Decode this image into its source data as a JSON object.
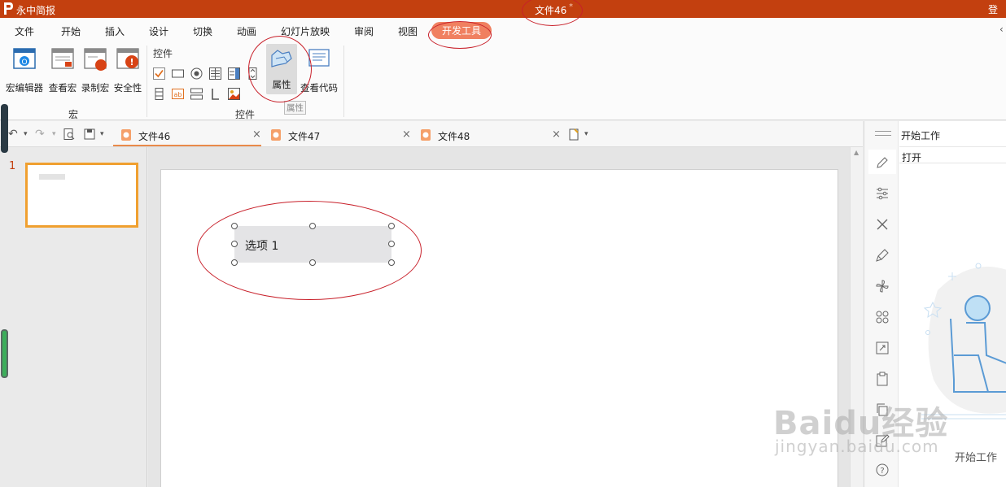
{
  "app": {
    "name": "永中简报",
    "document_title": "文件46",
    "modified_mark": "*",
    "login": "登录"
  },
  "menu": {
    "items": [
      "文件",
      "开始",
      "插入",
      "设计",
      "切换",
      "动画",
      "幻灯片放映",
      "审阅",
      "视图"
    ],
    "active": "开发工具"
  },
  "ribbon": {
    "macro_group": {
      "title": "宏",
      "buttons": [
        "宏编辑器",
        "查看宏",
        "录制宏",
        "安全性"
      ]
    },
    "controls_group": {
      "header": "控件",
      "title": "控件",
      "property_button": "属性",
      "view_code_button": "查看代码",
      "tooltip": "属性"
    }
  },
  "tabs": [
    {
      "name": "文件46",
      "active": true
    },
    {
      "name": "文件47",
      "active": false
    },
    {
      "name": "文件48",
      "active": false
    }
  ],
  "thumbnails": {
    "slide_number": "1"
  },
  "slide": {
    "listbox_text": "选项 1"
  },
  "task_pane": {
    "title": "开始工作",
    "open_item": "打开",
    "footer": "开始工作"
  },
  "watermark": {
    "line1": "Baidu经验",
    "line2": "jingyan.baidu.com"
  },
  "colors": {
    "title_bar": "#c3400f",
    "active_menu": "#f08060",
    "thumb_border": "#f0a030",
    "annotation": "#c8202a"
  }
}
